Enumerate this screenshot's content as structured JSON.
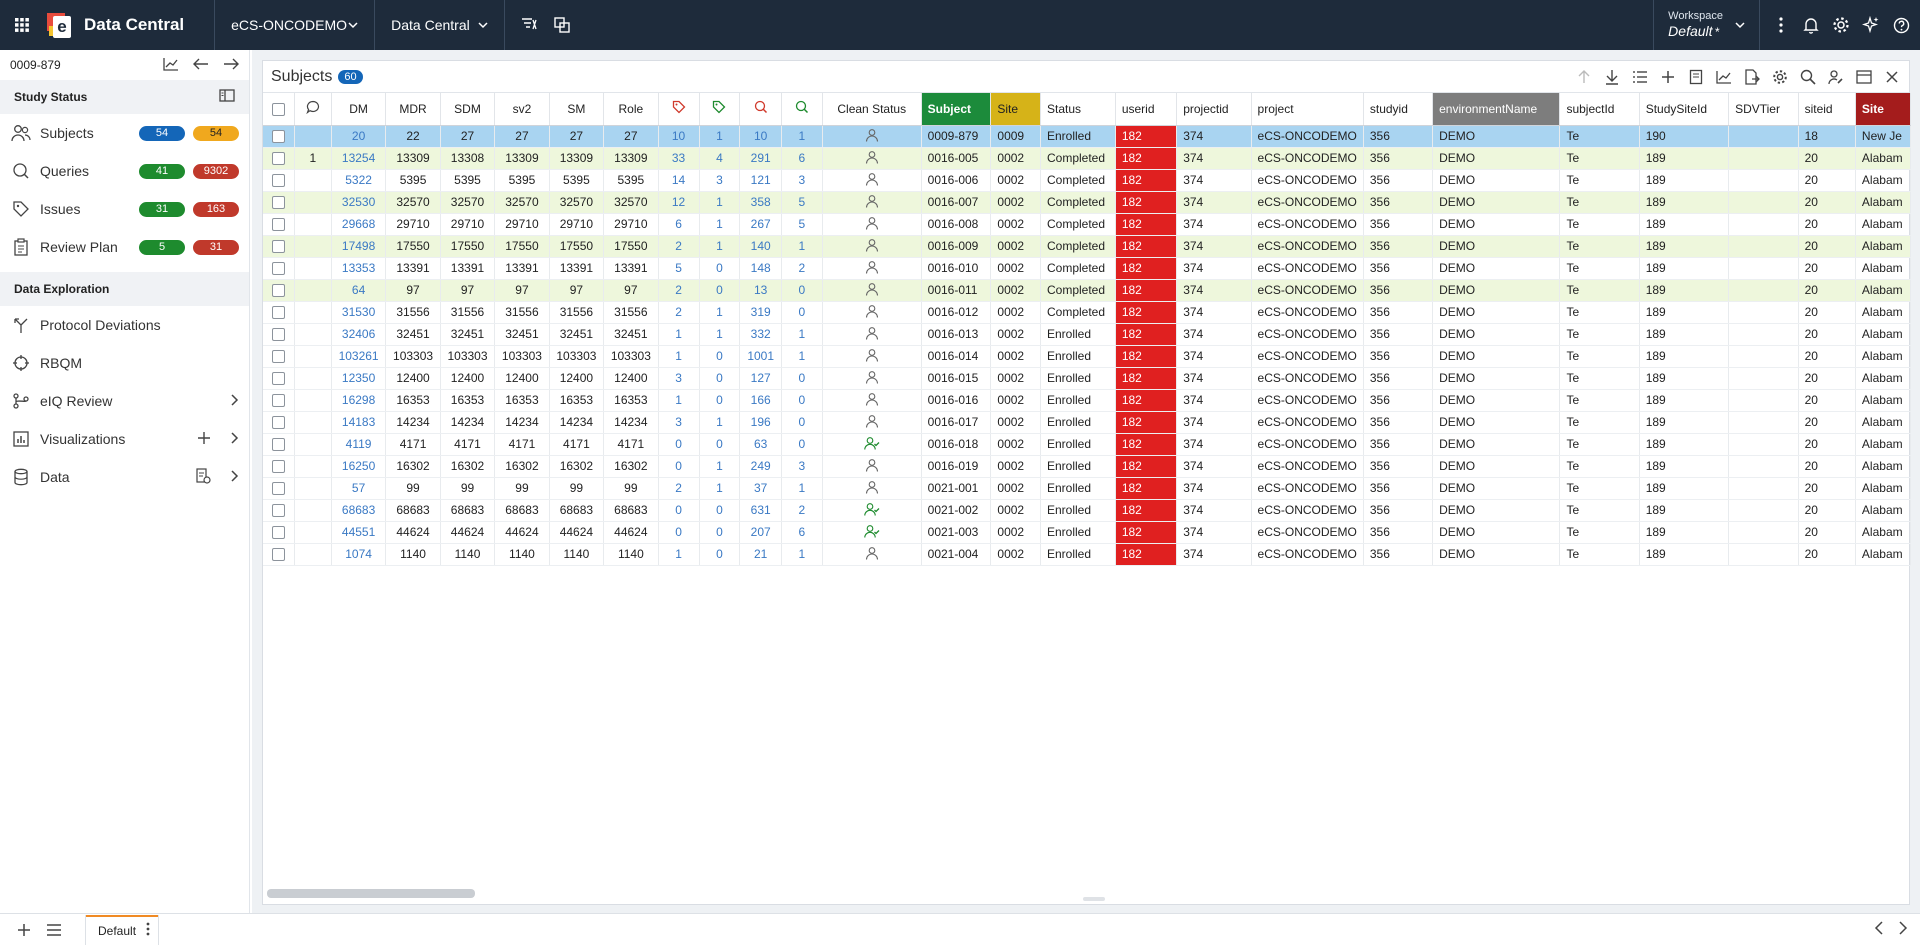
{
  "app": {
    "title": "Data Central",
    "study_dropdown": "eCS-ONCODEMO",
    "module_dropdown": "Data Central",
    "workspace_label": "Workspace",
    "workspace_value": "Default",
    "workspace_modified": "*"
  },
  "sidebar": {
    "subject_id": "0009-879",
    "study_status_title": "Study Status",
    "status_items": [
      {
        "label": "Subjects",
        "badge1": "54",
        "badge2": "54",
        "icon": "people-icon"
      },
      {
        "label": "Queries",
        "badge1": "41",
        "badge2": "9302",
        "icon": "query-icon"
      },
      {
        "label": "Issues",
        "badge1": "31",
        "badge2": "163",
        "icon": "tag-icon"
      },
      {
        "label": "Review Plan",
        "badge1": "5",
        "badge2": "31",
        "icon": "clipboard-icon"
      }
    ],
    "exploration_title": "Data Exploration",
    "exploration_items": [
      {
        "label": "Protocol Deviations"
      },
      {
        "label": "RBQM"
      },
      {
        "label": "eIQ Review"
      },
      {
        "label": "Visualizations"
      },
      {
        "label": "Data"
      }
    ]
  },
  "panel": {
    "title": "Subjects",
    "count": "60"
  },
  "grid": {
    "columns": [
      "",
      "",
      "DM",
      "MDR",
      "SDM",
      "sv2",
      "SM",
      "Role",
      "",
      "",
      "",
      "",
      "Clean Status",
      "Subject",
      "Site",
      "Status",
      "userid",
      "projectid",
      "project",
      "studyid",
      "environmentName",
      "subjectId",
      "StudySiteId",
      "SDVTier",
      "siteid",
      "Site"
    ],
    "rows": [
      {
        "c": "",
        "dm": "20",
        "mdr": "22",
        "sdm": "27",
        "sv2": "27",
        "sm": "27",
        "role": "27",
        "t1": "10",
        "t2": "1",
        "q1": "10",
        "q2": "1",
        "clean": "user",
        "subject": "0009-879",
        "site": "0009",
        "status": "Enrolled",
        "userid": "182",
        "projectid": "374",
        "project": "eCS-ONCODEMO",
        "studyid": "356",
        "env": "DEMO",
        "subjectId": "Te",
        "studySiteId": "190",
        "sdv": "",
        "siteid": "18",
        "siteName": "New Je"
      },
      {
        "c": "1",
        "dm": "13254",
        "mdr": "13309",
        "sdm": "13308",
        "sv2": "13309",
        "sm": "13309",
        "role": "13309",
        "t1": "33",
        "t2": "4",
        "q1": "291",
        "q2": "6",
        "clean": "user",
        "subject": "0016-005",
        "site": "0002",
        "status": "Completed",
        "userid": "182",
        "projectid": "374",
        "project": "eCS-ONCODEMO",
        "studyid": "356",
        "env": "DEMO",
        "subjectId": "Te",
        "studySiteId": "189",
        "sdv": "",
        "siteid": "20",
        "siteName": "Alabam"
      },
      {
        "c": "",
        "dm": "5322",
        "mdr": "5395",
        "sdm": "5395",
        "sv2": "5395",
        "sm": "5395",
        "role": "5395",
        "t1": "14",
        "t2": "3",
        "q1": "121",
        "q2": "3",
        "clean": "user",
        "subject": "0016-006",
        "site": "0002",
        "status": "Completed",
        "userid": "182",
        "projectid": "374",
        "project": "eCS-ONCODEMO",
        "studyid": "356",
        "env": "DEMO",
        "subjectId": "Te",
        "studySiteId": "189",
        "sdv": "",
        "siteid": "20",
        "siteName": "Alabam"
      },
      {
        "c": "",
        "dm": "32530",
        "mdr": "32570",
        "sdm": "32570",
        "sv2": "32570",
        "sm": "32570",
        "role": "32570",
        "t1": "12",
        "t2": "1",
        "q1": "358",
        "q2": "5",
        "clean": "user",
        "subject": "0016-007",
        "site": "0002",
        "status": "Completed",
        "userid": "182",
        "projectid": "374",
        "project": "eCS-ONCODEMO",
        "studyid": "356",
        "env": "DEMO",
        "subjectId": "Te",
        "studySiteId": "189",
        "sdv": "",
        "siteid": "20",
        "siteName": "Alabam"
      },
      {
        "c": "",
        "dm": "29668",
        "mdr": "29710",
        "sdm": "29710",
        "sv2": "29710",
        "sm": "29710",
        "role": "29710",
        "t1": "6",
        "t2": "1",
        "q1": "267",
        "q2": "5",
        "clean": "user",
        "subject": "0016-008",
        "site": "0002",
        "status": "Completed",
        "userid": "182",
        "projectid": "374",
        "project": "eCS-ONCODEMO",
        "studyid": "356",
        "env": "DEMO",
        "subjectId": "Te",
        "studySiteId": "189",
        "sdv": "",
        "siteid": "20",
        "siteName": "Alabam"
      },
      {
        "c": "",
        "dm": "17498",
        "mdr": "17550",
        "sdm": "17550",
        "sv2": "17550",
        "sm": "17550",
        "role": "17550",
        "t1": "2",
        "t2": "1",
        "q1": "140",
        "q2": "1",
        "clean": "user",
        "subject": "0016-009",
        "site": "0002",
        "status": "Completed",
        "userid": "182",
        "projectid": "374",
        "project": "eCS-ONCODEMO",
        "studyid": "356",
        "env": "DEMO",
        "subjectId": "Te",
        "studySiteId": "189",
        "sdv": "",
        "siteid": "20",
        "siteName": "Alabam"
      },
      {
        "c": "",
        "dm": "13353",
        "mdr": "13391",
        "sdm": "13391",
        "sv2": "13391",
        "sm": "13391",
        "role": "13391",
        "t1": "5",
        "t2": "0",
        "q1": "148",
        "q2": "2",
        "clean": "user",
        "subject": "0016-010",
        "site": "0002",
        "status": "Completed",
        "userid": "182",
        "projectid": "374",
        "project": "eCS-ONCODEMO",
        "studyid": "356",
        "env": "DEMO",
        "subjectId": "Te",
        "studySiteId": "189",
        "sdv": "",
        "siteid": "20",
        "siteName": "Alabam"
      },
      {
        "c": "",
        "dm": "64",
        "mdr": "97",
        "sdm": "97",
        "sv2": "97",
        "sm": "97",
        "role": "97",
        "t1": "2",
        "t2": "0",
        "q1": "13",
        "q2": "0",
        "clean": "user",
        "subject": "0016-011",
        "site": "0002",
        "status": "Completed",
        "userid": "182",
        "projectid": "374",
        "project": "eCS-ONCODEMO",
        "studyid": "356",
        "env": "DEMO",
        "subjectId": "Te",
        "studySiteId": "189",
        "sdv": "",
        "siteid": "20",
        "siteName": "Alabam"
      },
      {
        "c": "",
        "dm": "31530",
        "mdr": "31556",
        "sdm": "31556",
        "sv2": "31556",
        "sm": "31556",
        "role": "31556",
        "t1": "2",
        "t2": "1",
        "q1": "319",
        "q2": "0",
        "clean": "user",
        "subject": "0016-012",
        "site": "0002",
        "status": "Completed",
        "userid": "182",
        "projectid": "374",
        "project": "eCS-ONCODEMO",
        "studyid": "356",
        "env": "DEMO",
        "subjectId": "Te",
        "studySiteId": "189",
        "sdv": "",
        "siteid": "20",
        "siteName": "Alabam"
      },
      {
        "c": "",
        "dm": "32406",
        "mdr": "32451",
        "sdm": "32451",
        "sv2": "32451",
        "sm": "32451",
        "role": "32451",
        "t1": "1",
        "t2": "1",
        "q1": "332",
        "q2": "1",
        "clean": "user",
        "subject": "0016-013",
        "site": "0002",
        "status": "Enrolled",
        "userid": "182",
        "projectid": "374",
        "project": "eCS-ONCODEMO",
        "studyid": "356",
        "env": "DEMO",
        "subjectId": "Te",
        "studySiteId": "189",
        "sdv": "",
        "siteid": "20",
        "siteName": "Alabam"
      },
      {
        "c": "",
        "dm": "103261",
        "mdr": "103303",
        "sdm": "103303",
        "sv2": "103303",
        "sm": "103303",
        "role": "103303",
        "t1": "1",
        "t2": "0",
        "q1": "1001",
        "q2": "1",
        "clean": "user",
        "subject": "0016-014",
        "site": "0002",
        "status": "Enrolled",
        "userid": "182",
        "projectid": "374",
        "project": "eCS-ONCODEMO",
        "studyid": "356",
        "env": "DEMO",
        "subjectId": "Te",
        "studySiteId": "189",
        "sdv": "",
        "siteid": "20",
        "siteName": "Alabam"
      },
      {
        "c": "",
        "dm": "12350",
        "mdr": "12400",
        "sdm": "12400",
        "sv2": "12400",
        "sm": "12400",
        "role": "12400",
        "t1": "3",
        "t2": "0",
        "q1": "127",
        "q2": "0",
        "clean": "user",
        "subject": "0016-015",
        "site": "0002",
        "status": "Enrolled",
        "userid": "182",
        "projectid": "374",
        "project": "eCS-ONCODEMO",
        "studyid": "356",
        "env": "DEMO",
        "subjectId": "Te",
        "studySiteId": "189",
        "sdv": "",
        "siteid": "20",
        "siteName": "Alabam"
      },
      {
        "c": "",
        "dm": "16298",
        "mdr": "16353",
        "sdm": "16353",
        "sv2": "16353",
        "sm": "16353",
        "role": "16353",
        "t1": "1",
        "t2": "0",
        "q1": "166",
        "q2": "0",
        "clean": "user",
        "subject": "0016-016",
        "site": "0002",
        "status": "Enrolled",
        "userid": "182",
        "projectid": "374",
        "project": "eCS-ONCODEMO",
        "studyid": "356",
        "env": "DEMO",
        "subjectId": "Te",
        "studySiteId": "189",
        "sdv": "",
        "siteid": "20",
        "siteName": "Alabam"
      },
      {
        "c": "",
        "dm": "14183",
        "mdr": "14234",
        "sdm": "14234",
        "sv2": "14234",
        "sm": "14234",
        "role": "14234",
        "t1": "3",
        "t2": "1",
        "q1": "196",
        "q2": "0",
        "clean": "user",
        "subject": "0016-017",
        "site": "0002",
        "status": "Enrolled",
        "userid": "182",
        "projectid": "374",
        "project": "eCS-ONCODEMO",
        "studyid": "356",
        "env": "DEMO",
        "subjectId": "Te",
        "studySiteId": "189",
        "sdv": "",
        "siteid": "20",
        "siteName": "Alabam"
      },
      {
        "c": "",
        "dm": "4119",
        "mdr": "4171",
        "sdm": "4171",
        "sv2": "4171",
        "sm": "4171",
        "role": "4171",
        "t1": "0",
        "t2": "0",
        "q1": "63",
        "q2": "0",
        "clean": "user-check",
        "subject": "0016-018",
        "site": "0002",
        "status": "Enrolled",
        "userid": "182",
        "projectid": "374",
        "project": "eCS-ONCODEMO",
        "studyid": "356",
        "env": "DEMO",
        "subjectId": "Te",
        "studySiteId": "189",
        "sdv": "",
        "siteid": "20",
        "siteName": "Alabam"
      },
      {
        "c": "",
        "dm": "16250",
        "mdr": "16302",
        "sdm": "16302",
        "sv2": "16302",
        "sm": "16302",
        "role": "16302",
        "t1": "0",
        "t2": "1",
        "q1": "249",
        "q2": "3",
        "clean": "user",
        "subject": "0016-019",
        "site": "0002",
        "status": "Enrolled",
        "userid": "182",
        "projectid": "374",
        "project": "eCS-ONCODEMO",
        "studyid": "356",
        "env": "DEMO",
        "subjectId": "Te",
        "studySiteId": "189",
        "sdv": "",
        "siteid": "20",
        "siteName": "Alabam"
      },
      {
        "c": "",
        "dm": "57",
        "mdr": "99",
        "sdm": "99",
        "sv2": "99",
        "sm": "99",
        "role": "99",
        "t1": "2",
        "t2": "1",
        "q1": "37",
        "q2": "1",
        "clean": "user",
        "subject": "0021-001",
        "site": "0002",
        "status": "Enrolled",
        "userid": "182",
        "projectid": "374",
        "project": "eCS-ONCODEMO",
        "studyid": "356",
        "env": "DEMO",
        "subjectId": "Te",
        "studySiteId": "189",
        "sdv": "",
        "siteid": "20",
        "siteName": "Alabam"
      },
      {
        "c": "",
        "dm": "68683",
        "mdr": "68683",
        "sdm": "68683",
        "sv2": "68683",
        "sm": "68683",
        "role": "68683",
        "t1": "0",
        "t2": "0",
        "q1": "631",
        "q2": "2",
        "clean": "user-check",
        "subject": "0021-002",
        "site": "0002",
        "status": "Enrolled",
        "userid": "182",
        "projectid": "374",
        "project": "eCS-ONCODEMO",
        "studyid": "356",
        "env": "DEMO",
        "subjectId": "Te",
        "studySiteId": "189",
        "sdv": "",
        "siteid": "20",
        "siteName": "Alabam"
      },
      {
        "c": "",
        "dm": "44551",
        "mdr": "44624",
        "sdm": "44624",
        "sv2": "44624",
        "sm": "44624",
        "role": "44624",
        "t1": "0",
        "t2": "0",
        "q1": "207",
        "q2": "6",
        "clean": "user-check",
        "subject": "0021-003",
        "site": "0002",
        "status": "Enrolled",
        "userid": "182",
        "projectid": "374",
        "project": "eCS-ONCODEMO",
        "studyid": "356",
        "env": "DEMO",
        "subjectId": "Te",
        "studySiteId": "189",
        "sdv": "",
        "siteid": "20",
        "siteName": "Alabam"
      },
      {
        "c": "",
        "dm": "1074",
        "mdr": "1140",
        "sdm": "1140",
        "sv2": "1140",
        "sm": "1140",
        "role": "1140",
        "t1": "1",
        "t2": "0",
        "q1": "21",
        "q2": "1",
        "clean": "user",
        "subject": "0021-004",
        "site": "0002",
        "status": "Enrolled",
        "userid": "182",
        "projectid": "374",
        "project": "eCS-ONCODEMO",
        "studyid": "356",
        "env": "DEMO",
        "subjectId": "Te",
        "studySiteId": "189",
        "sdv": "",
        "siteid": "20",
        "siteName": "Alabam"
      }
    ]
  },
  "bottombar": {
    "tab_label": "Default"
  },
  "colors": {
    "topbar": "#1e2b3b",
    "selected_row": "#a9d4f1",
    "alt_row": "#eef7dc",
    "userid_cell": "#e02020",
    "subject_header": "#1c8b3b",
    "site_header": "#d6b318",
    "env_header": "#7d7d7d",
    "site2_header": "#a41c1c",
    "link": "#3a79c4"
  }
}
